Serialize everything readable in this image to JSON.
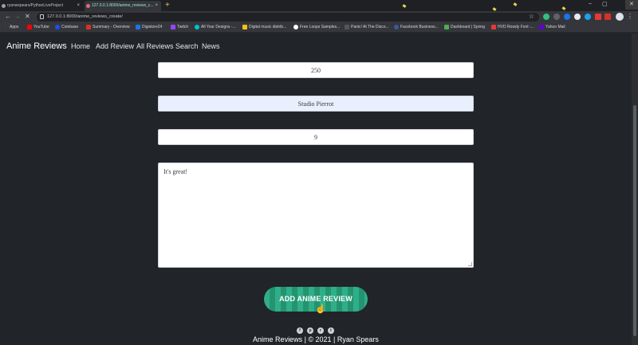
{
  "browser": {
    "tabs": [
      {
        "title": "ryanwspears/PythonLiveProject"
      },
      {
        "title": "127.0.0.1:8000/anime_reviews_c..."
      }
    ],
    "url": "127.0.0.1:8000/anime_reviews_create/",
    "bookmarks": [
      {
        "label": "Apps",
        "color": "#cc4444"
      },
      {
        "label": "YouTube",
        "color": "#ff0000"
      },
      {
        "label": "Coinbase",
        "color": "#1652f0"
      },
      {
        "label": "Summary - Overview",
        "color": "#d93025"
      },
      {
        "label": "Digistore24",
        "color": "#1a73e8"
      },
      {
        "label": "Twitch",
        "color": "#9146ff"
      },
      {
        "label": "All Your Designs -...",
        "color": "#00c4cc"
      },
      {
        "label": "Digital music distrib...",
        "color": "#f1c40f"
      },
      {
        "label": "Free Loops Samples...",
        "color": "#ffffff"
      },
      {
        "label": "Panic! At The Disco...",
        "color": "#555555"
      },
      {
        "label": "Facebook Business...",
        "color": "#3b5998"
      },
      {
        "label": "Dashboard | Spring",
        "color": "#4caf50"
      },
      {
        "label": "HVD Rowdy Font -...",
        "color": "#e53935"
      },
      {
        "label": "Yahoo Mail",
        "color": "#6001d2"
      }
    ]
  },
  "navbar": {
    "brand": "Anime Reviews",
    "links": [
      "Home",
      "Add Review",
      "All Reviews",
      "Search",
      "News"
    ]
  },
  "form": {
    "episodes_value": "250",
    "studio_value": "Studio Pierrot",
    "rating_value": "9",
    "review_value": "It's great!",
    "submit_label": "ADD ANIME REVIEW"
  },
  "footer": {
    "text": "Anime Reviews | © 2021 | Ryan Spears",
    "social_icons": [
      "facebook-icon",
      "pinterest-icon",
      "reddit-icon",
      "twitter-icon"
    ]
  }
}
